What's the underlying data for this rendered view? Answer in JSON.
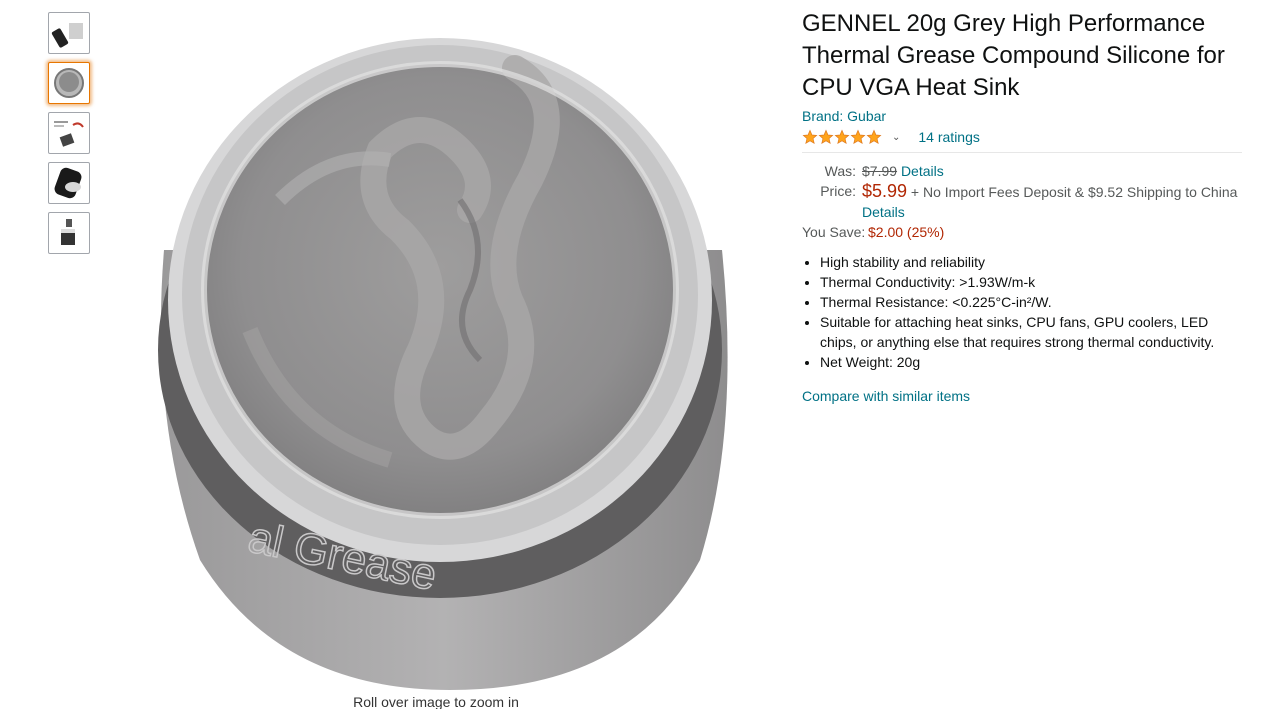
{
  "thumbnails": [
    {
      "name": "thumb-jar-side",
      "selected": false
    },
    {
      "name": "thumb-jar-top",
      "selected": true
    },
    {
      "name": "thumb-diagram",
      "selected": false
    },
    {
      "name": "thumb-jar-black",
      "selected": false
    },
    {
      "name": "thumb-jar-small",
      "selected": false
    }
  ],
  "image": {
    "zoom_hint": "Roll over image to zoom in",
    "label_text": "al Grease"
  },
  "product": {
    "title": "GENNEL 20g Grey High Performance Thermal Grease Compound Silicone for CPU VGA Heat Sink",
    "brand": "Brand: Gubar",
    "rating_stars": 5,
    "ratings_count": "14 ratings"
  },
  "pricing": {
    "was_label": "Was:",
    "was_price": "$7.99",
    "was_details": "Details",
    "price_label": "Price:",
    "price": "$5.99",
    "shipping_text": " + No Import Fees Deposit & $9.52 Shipping to China ",
    "price_details": "Details",
    "save_label": "You Save:",
    "save_value": "$2.00 (25%)"
  },
  "features": [
    "High stability and reliability",
    "Thermal Conductivity: >1.93W/m-k",
    "Thermal Resistance: <0.225°C-in²/W.",
    "Suitable for attaching heat sinks, CPU fans, GPU coolers, LED chips, or anything else that requires strong thermal conductivity.",
    "Net Weight: 20g"
  ],
  "compare_link": "Compare with similar items",
  "colors": {
    "link": "#007185",
    "price": "#b12704",
    "star": "#ffa41c",
    "selected_border": "#e77600"
  }
}
